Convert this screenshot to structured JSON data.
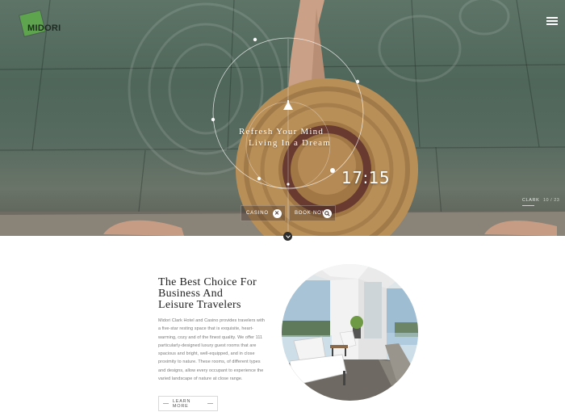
{
  "brand": {
    "logo_text": "MIDORI",
    "accent": "#5ea44e"
  },
  "header": {
    "menu_icon": "hamburger-icon"
  },
  "hero": {
    "tagline_line1": "Refresh Your Mind",
    "tagline_line2": "Living In a Dream",
    "time": "17:15",
    "buttons": [
      {
        "label": "CASINO",
        "icon": "casino-icon",
        "glyph": "✕"
      },
      {
        "label": "BOOK NOW",
        "icon": "search-icon",
        "glyph": ""
      }
    ],
    "slide_label": "CLARK",
    "slide_counter": "10 / 23"
  },
  "intro": {
    "headline_line1": "The Best Choice For",
    "headline_line2": "Business And",
    "headline_line3": "Leisure Travelers",
    "body": "Midori Clark Hotel and Casino provides travelers with a five-star resting space that is exquisite, heart-warming, cozy and of the finest quality. We offer 111 particularly-designed luxury guest rooms that are spacious and bright, well-equipped, and in close proximity to nature. These rooms, of different types and designs, allow every occupant to experience the varied landscape of nature at close range.",
    "cta_label": "LEARN MORE"
  }
}
